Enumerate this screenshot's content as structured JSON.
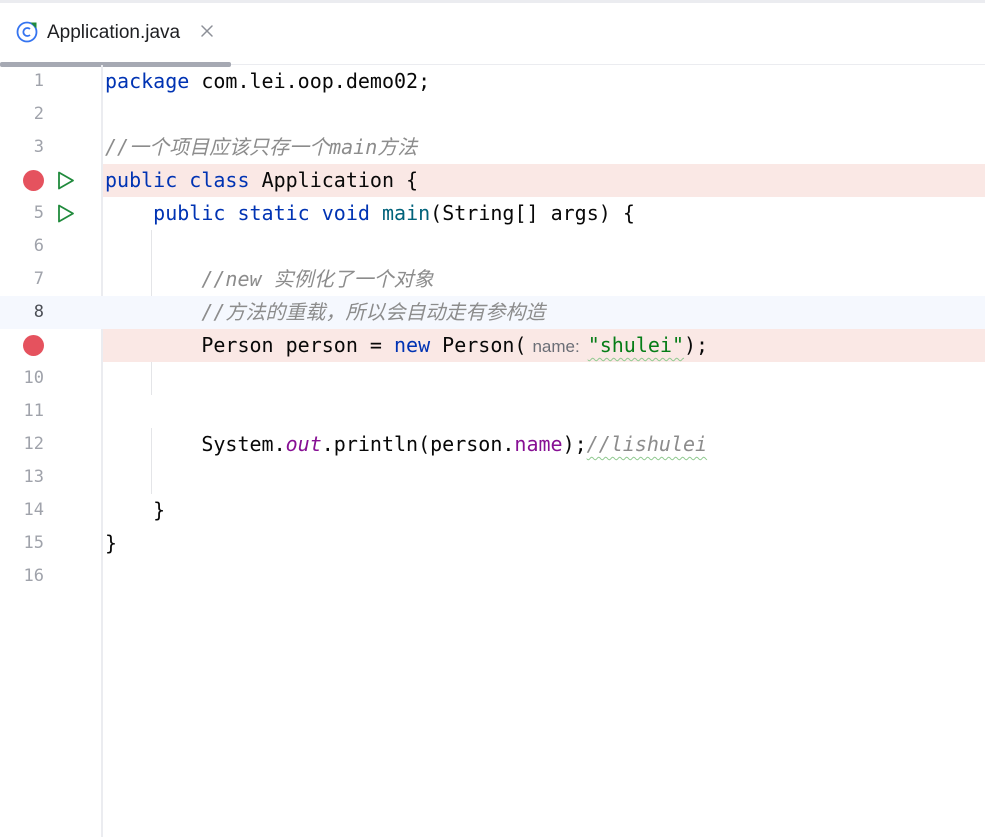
{
  "tab": {
    "title": "Application.java",
    "icon": "java-class-icon",
    "close_icon": "close-icon"
  },
  "gutter": {
    "line_numbers": [
      "1",
      "2",
      "3",
      "4",
      "5",
      "6",
      "7",
      "8",
      "9",
      "10",
      "11",
      "12",
      "13",
      "14",
      "15",
      "16"
    ],
    "breakpoint_lines": [
      4,
      9
    ],
    "run_lines": [
      4,
      5
    ],
    "current_line": 8
  },
  "colors": {
    "keyword": "#0033b3",
    "method": "#00627a",
    "string": "#067d17",
    "field": "#871094",
    "comment": "#8c8c8c",
    "breakpoint": "#e5525e",
    "breakpoint_line_bg": "#fae8e5",
    "current_line_bg": "#f5f8fe",
    "run_icon": "#208a3c"
  },
  "code": {
    "l1": {
      "kw": "package",
      "rest": " com.lei.oop.demo02;"
    },
    "l3": {
      "comment": "//一个项目应该只存一个main方法"
    },
    "l4": {
      "kw1": "public",
      "kw2": "class",
      "name": "Application",
      "brace": " {"
    },
    "l5": {
      "indent": "    ",
      "kw1": "public",
      "kw2": "static",
      "kw3": "void",
      "method": "main",
      "params": "(String[] args) {"
    },
    "l7": {
      "indent": "        ",
      "comment": "//new 实例化了一个对象"
    },
    "l8": {
      "indent": "        ",
      "comment": "//方法的重载，所以会自动走有参构造"
    },
    "l9": {
      "indent": "        ",
      "pre": "Person person = ",
      "kw": "new",
      "call": " Person(",
      "hint": "name:",
      "str": "\"shulei\"",
      "end": ");"
    },
    "l12": {
      "indent": "        ",
      "sys": "System.",
      "out": "out",
      "mid": ".println(person.",
      "field": "name",
      "end": ");",
      "comment": "//lishulei"
    },
    "l14": {
      "text": "    }"
    },
    "l15": {
      "text": "}"
    }
  }
}
